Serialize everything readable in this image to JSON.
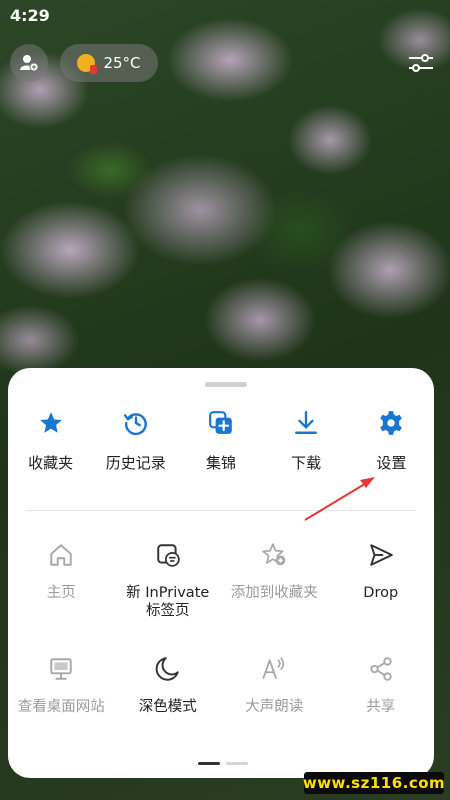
{
  "status_bar": {
    "time": "4:29"
  },
  "top_bar": {
    "profile_icon": "profile-icon",
    "weather": {
      "icon": "sun-icon",
      "temperature": "25°C"
    },
    "customize_icon": "sliders-icon"
  },
  "menu": {
    "primary_items": [
      {
        "label": "收藏夹",
        "icon": "star-icon"
      },
      {
        "label": "历史记录",
        "icon": "history-icon"
      },
      {
        "label": "集锦",
        "icon": "collections-icon"
      },
      {
        "label": "下载",
        "icon": "download-icon"
      },
      {
        "label": "设置",
        "icon": "gear-icon"
      }
    ],
    "secondary_items": [
      {
        "label": "主页",
        "icon": "home-icon",
        "enabled": false
      },
      {
        "label_line1": "新 InPrivate",
        "label_line2": "标签页",
        "icon": "inprivate-icon",
        "enabled": true
      },
      {
        "label": "添加到收藏夹",
        "icon": "add-favorite-icon",
        "enabled": false
      },
      {
        "label": "Drop",
        "icon": "send-icon",
        "enabled": true
      },
      {
        "label": "查看桌面网站",
        "icon": "desktop-icon",
        "enabled": false
      },
      {
        "label": "深色模式",
        "icon": "moon-icon",
        "enabled": true
      },
      {
        "label": "大声朗读",
        "icon": "read-aloud-icon",
        "enabled": false
      },
      {
        "label": "共享",
        "icon": "share-icon",
        "enabled": false
      }
    ],
    "page_indicator": {
      "current": 1,
      "total": 2
    }
  },
  "watermark": {
    "text": "www.sz116.com"
  },
  "colors": {
    "accent": "#1976d2",
    "annotation_arrow": "#e53935"
  }
}
